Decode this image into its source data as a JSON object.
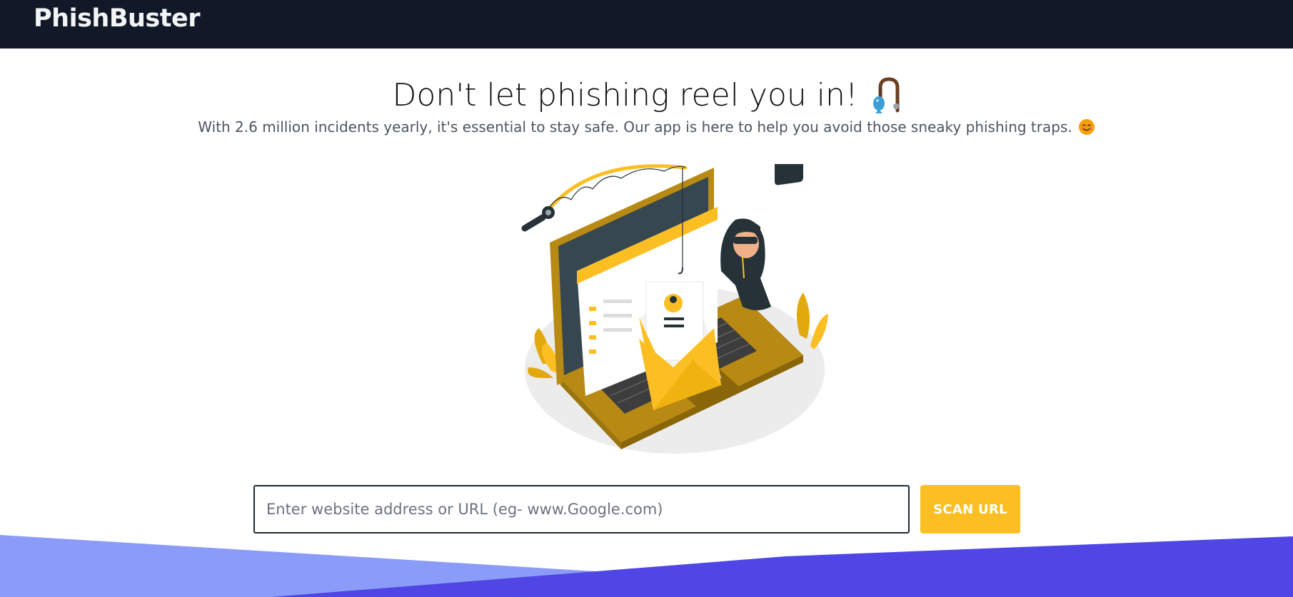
{
  "nav": {
    "brand": "PhishBuster"
  },
  "hero": {
    "headline": "Don't let phishing reel you in!",
    "subheadline": "With 2.6 million incidents yearly, it's essential to stay safe. Our app is here to help you avoid those sneaky phishing traps."
  },
  "search": {
    "placeholder": "Enter website address or URL (eg- www.Google.com)",
    "value": "",
    "button_label": "SCAN URL"
  },
  "icons": {
    "headline_emoji": "fishing-pole-icon",
    "subheadline_emoji": "smiling-face-icon"
  },
  "colors": {
    "nav_bg": "#111827",
    "accent": "#fbbf24",
    "wave_light": "#8b9cf8",
    "wave_dark": "#4f46e5"
  }
}
